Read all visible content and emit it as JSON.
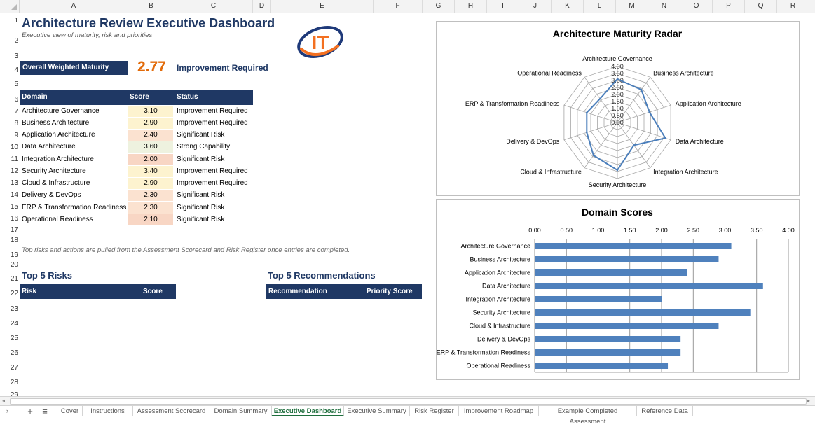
{
  "columns": [
    "A",
    "B",
    "C",
    "D",
    "E",
    "F",
    "G",
    "H",
    "I",
    "J",
    "K",
    "L",
    "M",
    "N",
    "O",
    "P",
    "Q",
    "R"
  ],
  "rows": [
    "1",
    "2",
    "3",
    "4",
    "5",
    "6",
    "7",
    "8",
    "9",
    "10",
    "11",
    "12",
    "13",
    "14",
    "15",
    "16",
    "17",
    "18",
    "19",
    "20",
    "21",
    "22",
    "23",
    "24",
    "25",
    "26",
    "27",
    "28",
    "29"
  ],
  "dashboard": {
    "title": "Architecture Review Executive Dashboard",
    "subtitle": "Executive view of maturity, risk and priorities",
    "logo_text": "IT",
    "overall_label": "Overall Weighted Maturity",
    "overall_value": "2.77",
    "overall_status": "Improvement Required",
    "table_headers": {
      "domain": "Domain",
      "score": "Score",
      "status": "Status"
    },
    "domains": [
      {
        "name": "Architecture Governance",
        "score": "3.10",
        "status": "Improvement Required",
        "color": "#fdf3cf"
      },
      {
        "name": "Business Architecture",
        "score": "2.90",
        "status": "Improvement Required",
        "color": "#fdf3cf"
      },
      {
        "name": "Application Architecture",
        "score": "2.40",
        "status": "Significant Risk",
        "color": "#fbe2d0"
      },
      {
        "name": "Data Architecture",
        "score": "3.60",
        "status": "Strong Capability",
        "color": "#eef2df"
      },
      {
        "name": "Integration Architecture",
        "score": "2.00",
        "status": "Significant Risk",
        "color": "#f8d6c4"
      },
      {
        "name": "Security Architecture",
        "score": "3.40",
        "status": "Improvement Required",
        "color": "#fdf3cf"
      },
      {
        "name": "Cloud & Infrastructure",
        "score": "2.90",
        "status": "Improvement Required",
        "color": "#fdf3cf"
      },
      {
        "name": "Delivery & DevOps",
        "score": "2.30",
        "status": "Significant Risk",
        "color": "#fbe2d0"
      },
      {
        "name": "ERP & Transformation Readiness",
        "score": "2.30",
        "status": "Significant Risk",
        "color": "#fbe2d0"
      },
      {
        "name": "Operational Readiness",
        "score": "2.10",
        "status": "Significant Risk",
        "color": "#f8d6c4"
      }
    ],
    "note": "Top risks and actions are pulled from the Assessment Scorecard and Risk Register once entries are completed.",
    "risks_title": "Top 5 Risks",
    "risks_headers": {
      "risk": "Risk",
      "score": "Score"
    },
    "recs_title": "Top 5 Recommendations",
    "recs_headers": {
      "recommendation": "Recommendation",
      "priority": "Priority Score"
    }
  },
  "chart_data": [
    {
      "type": "radar",
      "title": "Architecture Maturity Radar",
      "categories": [
        "Architecture Governance",
        "Business Architecture",
        "Application Architecture",
        "Data Architecture",
        "Integration Architecture",
        "Security Architecture",
        "Cloud & Infrastructure",
        "Delivery & DevOps",
        "ERP & Transformation Readiness",
        "Operational Readiness"
      ],
      "values": [
        3.1,
        2.9,
        2.4,
        3.6,
        2.0,
        3.4,
        2.9,
        2.3,
        2.3,
        2.1
      ],
      "rlim": [
        0,
        4
      ],
      "ticks": [
        "0.00",
        "0.50",
        "1.00",
        "1.50",
        "2.00",
        "2.50",
        "3.00",
        "3.50",
        "4.00"
      ],
      "color": "#4a7ebb"
    },
    {
      "type": "bar",
      "orientation": "horizontal",
      "title": "Domain Scores",
      "categories": [
        "Architecture Governance",
        "Business Architecture",
        "Application Architecture",
        "Data Architecture",
        "Integration Architecture",
        "Security Architecture",
        "Cloud & Infrastructure",
        "Delivery & DevOps",
        "ERP & Transformation Readiness",
        "Operational Readiness"
      ],
      "values": [
        3.1,
        2.9,
        2.4,
        3.6,
        2.0,
        3.4,
        2.9,
        2.3,
        2.3,
        2.1
      ],
      "xlim": [
        0,
        4
      ],
      "ticks": [
        "0.00",
        "0.50",
        "1.00",
        "1.50",
        "2.00",
        "2.50",
        "3.00",
        "3.50",
        "4.00"
      ],
      "color": "#4f81bd"
    }
  ],
  "sheet_tabs": [
    {
      "label": "Cover",
      "active": false
    },
    {
      "label": "Instructions",
      "active": false
    },
    {
      "label": "Assessment Scorecard",
      "active": false
    },
    {
      "label": "Domain Summary",
      "active": false
    },
    {
      "label": "Executive Dashboard",
      "active": true
    },
    {
      "label": "Executive Summary",
      "active": false
    },
    {
      "label": "Risk Register",
      "active": false
    },
    {
      "label": "Improvement Roadmap",
      "active": false
    },
    {
      "label": "Example Completed Assessment",
      "active": false
    },
    {
      "label": "Reference Data",
      "active": false
    }
  ],
  "tab_controls": {
    "add": "+",
    "menu": "≡",
    "nav": "›"
  }
}
